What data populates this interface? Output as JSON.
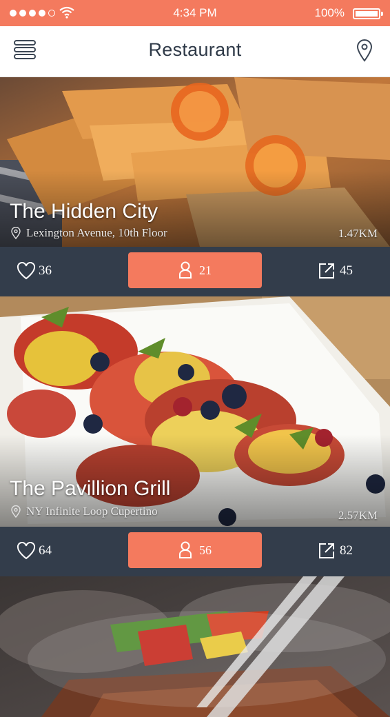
{
  "status_bar": {
    "time": "4:34 PM",
    "battery": "100%",
    "icons": [
      "signal-dots",
      "wifi-icon",
      "battery-icon"
    ]
  },
  "header": {
    "title": "Restaurant",
    "left_icon": "menu-icon",
    "right_icon": "location-pin-icon"
  },
  "colors": {
    "accent": "#f47a5e",
    "action_bar": "#333d4b",
    "title_text": "#2f3a48"
  },
  "restaurants": [
    {
      "name": "The Hidden City",
      "address": "Lexington Avenue, 10th Floor",
      "distance": "1.47KM",
      "likes": "36",
      "guests": "21",
      "shares": "45"
    },
    {
      "name": "The Pavillion Grill",
      "address": "NY Infinite Loop Cupertino",
      "distance": "2.57KM",
      "likes": "64",
      "guests": "56",
      "shares": "82"
    }
  ]
}
